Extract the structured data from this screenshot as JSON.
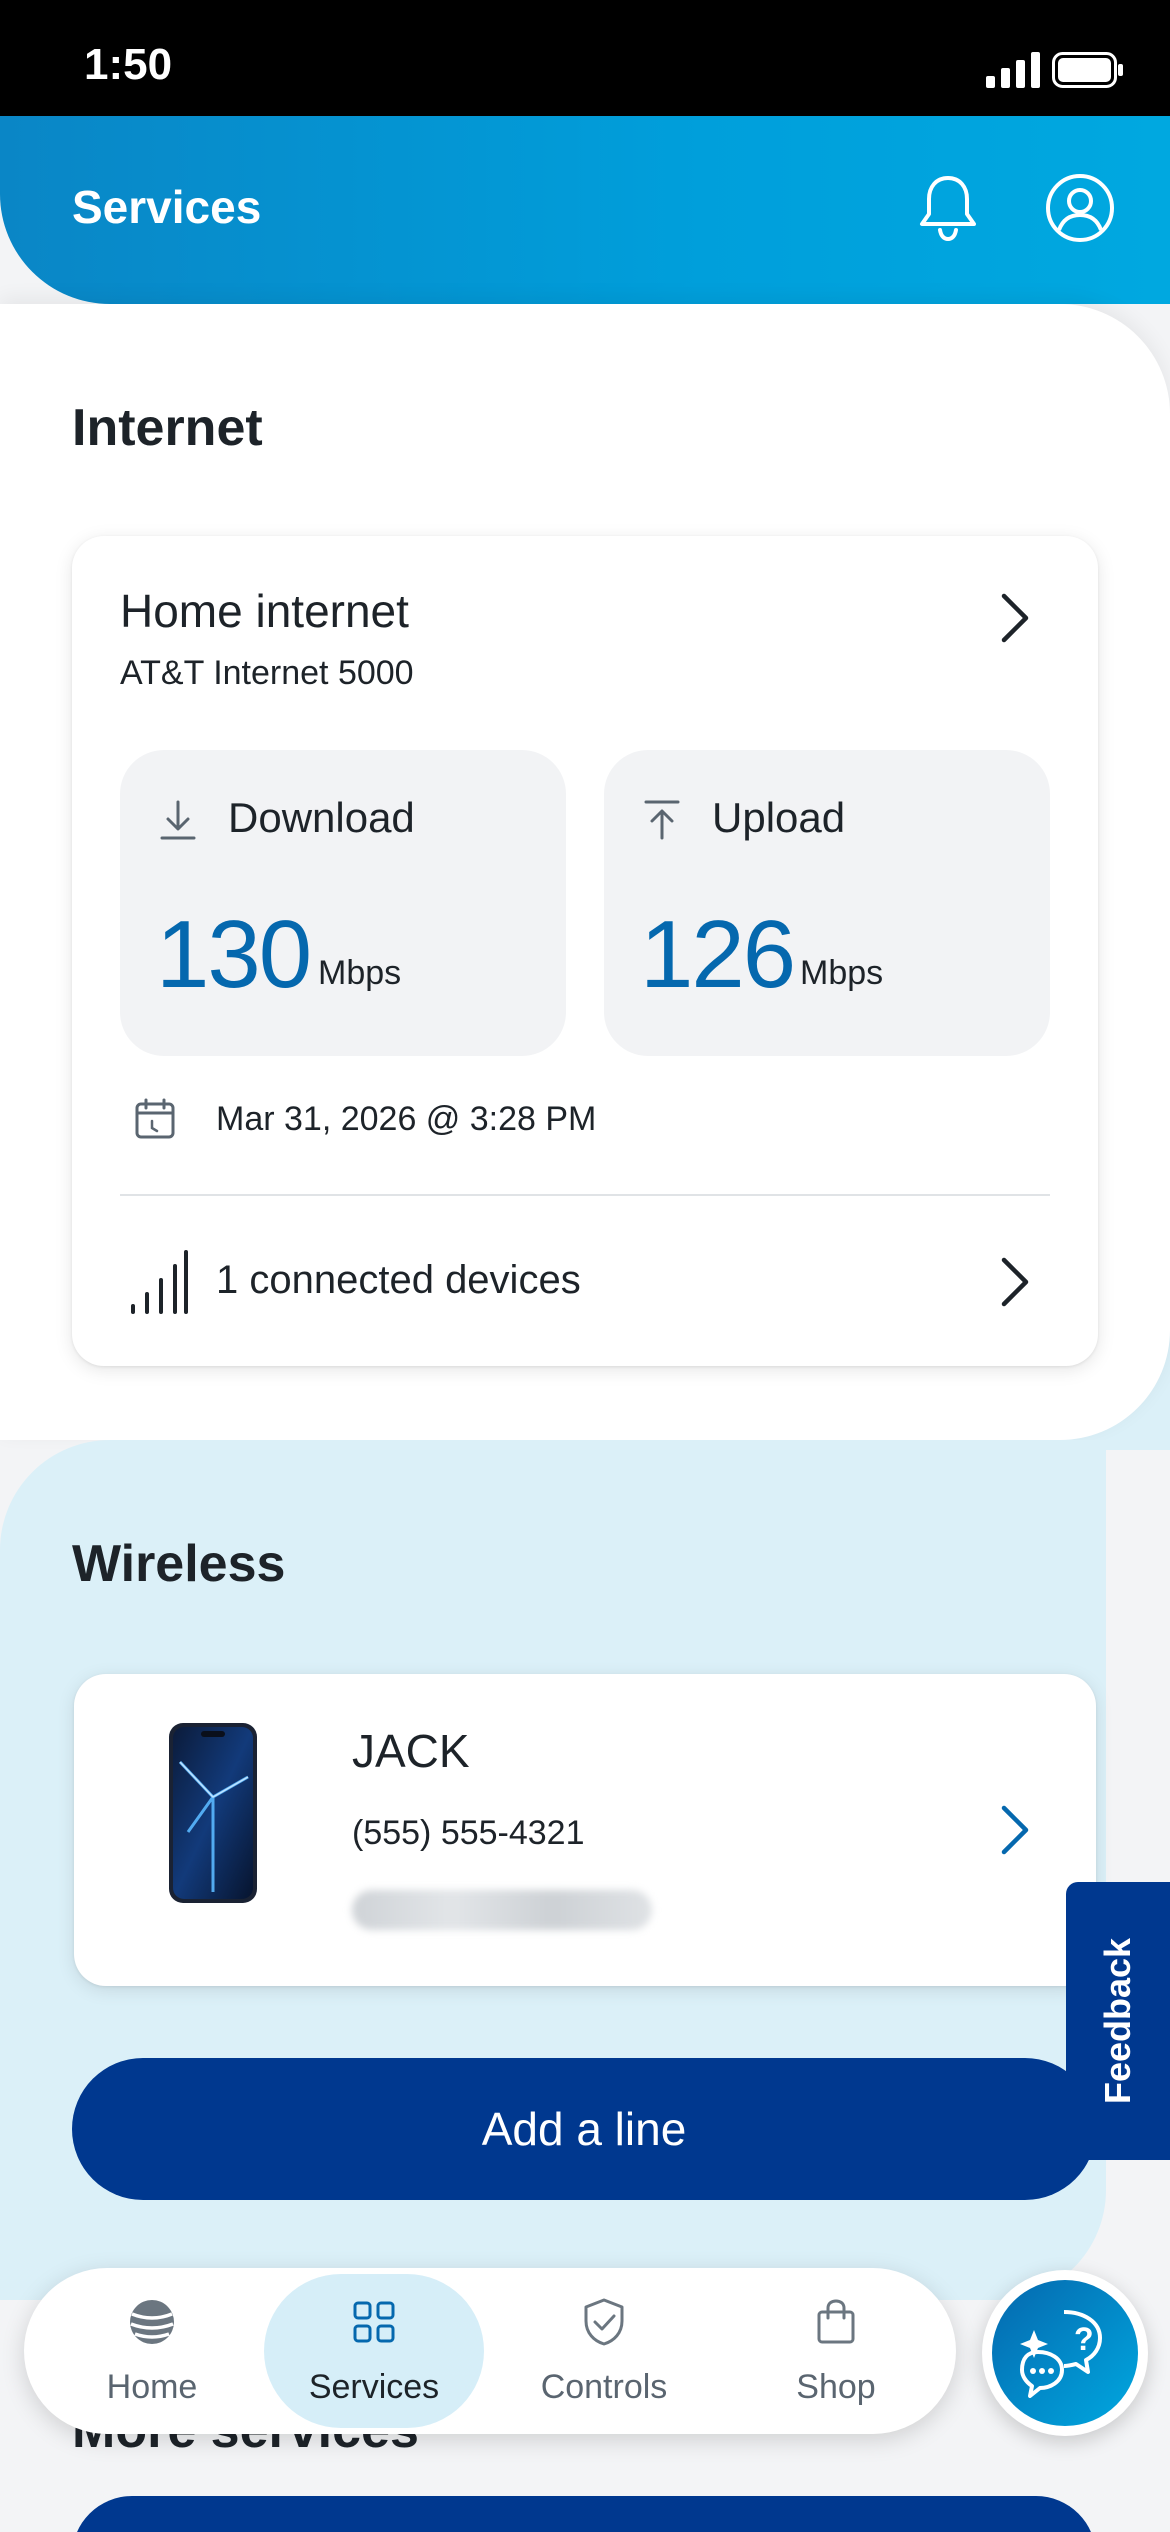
{
  "status_bar": {
    "time": "1:50"
  },
  "header": {
    "title": "Services"
  },
  "internet": {
    "section_title": "Internet",
    "card_title": "Home internet",
    "plan": "AT&T Internet 5000",
    "download": {
      "label": "Download",
      "value": "130",
      "unit": "Mbps"
    },
    "upload": {
      "label": "Upload",
      "value": "126",
      "unit": "Mbps"
    },
    "timestamp": "Mar 31, 2026 @ 3:28 PM",
    "devices": "1 connected devices"
  },
  "wireless": {
    "section_title": "Wireless",
    "line": {
      "name": "JACK",
      "number": "(555) 555-4321"
    },
    "add_line": "Add a line"
  },
  "feedback": "Feedback",
  "more": {
    "section_title": "More services"
  },
  "tabs": [
    {
      "label": "Home",
      "icon": "att-globe-icon"
    },
    {
      "label": "Services",
      "icon": "grid-icon",
      "active": true
    },
    {
      "label": "Controls",
      "icon": "shield-check-icon"
    },
    {
      "label": "Shop",
      "icon": "shopping-bag-icon"
    }
  ],
  "colors": {
    "brand_blue": "#009fdb",
    "cobalt": "#00388f",
    "speed_blue": "#0568ae",
    "wireless_bg": "#dbf0f8"
  }
}
